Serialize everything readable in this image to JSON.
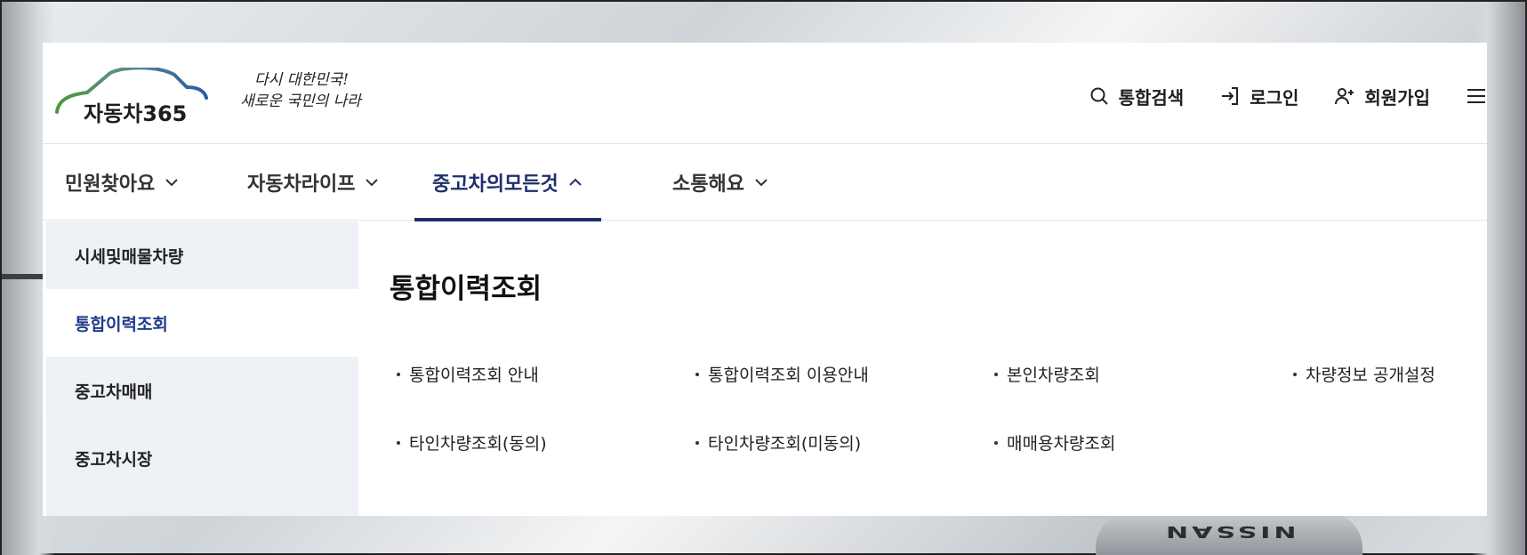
{
  "background": {
    "badge_text": "NISSAN"
  },
  "header": {
    "logo_text": "자동차365",
    "slogan_line1": "다시 대한민국!",
    "slogan_line2": "새로운 국민의 나라",
    "utils": {
      "search_label": "통합검색",
      "login_label": "로그인",
      "signup_label": "회원가입"
    },
    "accent_color": "#1e2f6b"
  },
  "gnb": {
    "items": [
      {
        "label": "민원찾아요"
      },
      {
        "label": "자동차라이프"
      },
      {
        "label": "중고차의모든것"
      },
      {
        "label": "소통해요"
      }
    ],
    "active_index": 2
  },
  "side": {
    "items": [
      {
        "label": "시세및매물차량"
      },
      {
        "label": "통합이력조회"
      },
      {
        "label": "중고차매매"
      },
      {
        "label": "중고차시장"
      }
    ],
    "active_index": 1
  },
  "content": {
    "title": "통합이력조회",
    "links": [
      {
        "label": "통합이력조회 안내"
      },
      {
        "label": "통합이력조회 이용안내"
      },
      {
        "label": "본인차량조회"
      },
      {
        "label": "차량정보 공개설정"
      },
      {
        "label": "타인차량조회(동의)"
      },
      {
        "label": "타인차량조회(미동의)"
      },
      {
        "label": "매매용차량조회"
      }
    ]
  }
}
